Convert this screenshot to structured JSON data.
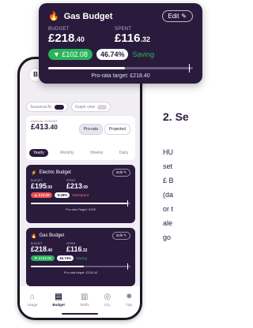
{
  "zoom_card": {
    "name": "Gas Budget",
    "edit_label": "Edit",
    "budget_label": "BUDGET",
    "budget_main": "£218",
    "budget_pence": ".40",
    "spent_label": "SPENT",
    "spent_main": "£116",
    "spent_pence": ".32",
    "remaining": "▼ £102.08",
    "percent": "46.74%",
    "status": "Saving",
    "prorata": "Pro-rata target: £218.40",
    "progress": 0.53
  },
  "phone": {
    "toggles": [
      "Seasonal Ac",
      "Graph view"
    ],
    "summary": {
      "label": "ANNUAL BUDGET",
      "main": "£413",
      "pence": ".40",
      "segments": [
        "Pro-rata",
        "Projected"
      ],
      "periods": [
        "Yearly",
        "Monthly",
        "Weekly",
        "Daily"
      ]
    },
    "electric": {
      "name": "Electric Budget",
      "edit_label": "Edit",
      "budget_label": "BUDGET",
      "budget_main": "£195",
      "budget_pence": ".00",
      "spent_label": "SPENT",
      "spent_main": "£213",
      "spent_pence": ".09",
      "remaining": "▲ £18.09",
      "percent": "9.28%",
      "status": "Overspent",
      "prorata": "Pro-rata Target: £195",
      "progress": 0.97
    },
    "gas": {
      "name": "Gas Budget",
      "edit_label": "Edit",
      "budget_label": "BUDGET",
      "budget_main": "£218",
      "budget_pence": ".40",
      "spent_label": "SPENT",
      "spent_main": "£116",
      "spent_pence": ".32",
      "remaining": "▼ £102.08",
      "percent": "46.74%",
      "status": "Saving",
      "prorata": "Pro-rata target: £218.40",
      "progress": 0.53
    },
    "nav": [
      "Usage",
      "Budget",
      "Tariffs",
      "CO₂",
      "Tips"
    ]
  },
  "side": {
    "heading": "2. Se",
    "lines": [
      "HU",
      "set",
      "£ B",
      "(da",
      "or t",
      "ale",
      "go"
    ]
  }
}
